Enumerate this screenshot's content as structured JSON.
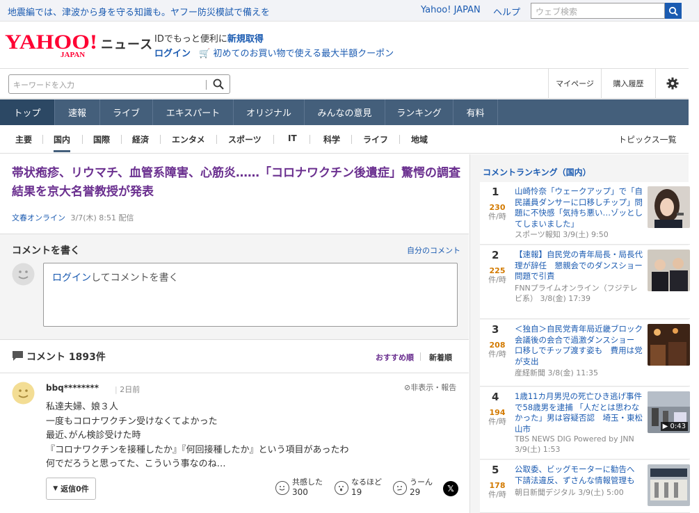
{
  "topbar": {
    "promo": "地震編では、津波から身を守る知識も。ヤフー防災模試で備えを",
    "yahoo_japan": "Yahoo! JAPAN",
    "help": "ヘルプ",
    "search_placeholder": "ウェブ検索"
  },
  "header": {
    "logo_text": "YAHOO!",
    "logo_sub": "JAPAN",
    "service": "ニュース",
    "line1_prefix": "IDでもっと便利に",
    "line1_link": "新規取得",
    "login": "ログイン",
    "coupon": "初めてのお買い物で使える最大半額クーポン"
  },
  "search": {
    "placeholder": "キーワードを入力",
    "mypage": "マイページ",
    "history": "購入履歴"
  },
  "main_nav": [
    "トップ",
    "速報",
    "ライブ",
    "エキスパート",
    "オリジナル",
    "みんなの意見",
    "ランキング",
    "有料"
  ],
  "sub_nav": [
    "主要",
    "国内",
    "国際",
    "経済",
    "エンタメ",
    "スポーツ",
    "IT",
    "科学",
    "ライフ",
    "地域"
  ],
  "topics_all": "トピックス一覧",
  "article": {
    "title": "帯状疱疹、リウマチ、血管系障害、心筋炎……「コロナワクチン後遺症」驚愕の調査結果を京大名誉教授が発表",
    "source": "文春オンライン",
    "date": "3/7(木) 8:51 配信"
  },
  "comment_box": {
    "heading": "コメントを書く",
    "my_comments": "自分のコメント",
    "login_link": "ログイン",
    "prompt": "してコメントを書く"
  },
  "comments": {
    "heading": "コメント 1893件",
    "sort_recommended": "おすすめ順",
    "sort_new": "新着順",
    "items": [
      {
        "user": "bbq********",
        "time": "2日前",
        "hide": "非表示・報告",
        "lines": [
          "私達夫婦、娘３人",
          "一度もコロナワクチン受けなくてよかった",
          "最近､がん検診受けた時",
          "『コロナワクチンを接種したか』『何回接種したか』という項目があったわ",
          "何でだろうと思ってた、こういう事なのね…"
        ],
        "replies": "返信0件",
        "reactions": [
          {
            "label": "共感した",
            "count": "300"
          },
          {
            "label": "なるほど",
            "count": "19"
          },
          {
            "label": "うーん",
            "count": "29"
          }
        ]
      }
    ]
  },
  "ranking": {
    "title": "コメントランキング（国内）",
    "per_hour": "件/時",
    "items": [
      {
        "rank": "1",
        "count": "230",
        "headline": "山崎怜奈「ウェークアップ」で「自民議員ダンサーに口移しチップ」問題に不快感「気持ち悪い…ゾッとしてしまいました」",
        "source": "スポーツ報知 3/9(土) 9:50"
      },
      {
        "rank": "2",
        "count": "225",
        "headline": "【速報】自民党の青年局長・局長代理が辞任　懇親会でのダンスショー問題で引責",
        "source": "FNNプライムオンライン（フジテレビ系） 3/8(金) 17:39"
      },
      {
        "rank": "3",
        "count": "208",
        "headline": "＜独自＞自民党青年局近畿ブロック会議後の会合で過激ダンスショー　口移しでチップ渡す姿も　費用は党が支出",
        "source": "産経新聞 3/8(金) 11:35"
      },
      {
        "rank": "4",
        "count": "194",
        "headline": "1歳11カ月男児の死亡ひき逃げ事件で58歳男を逮捕 「人だとは思わなかった」男は容疑否認　埼玉・東松山市",
        "source": "TBS NEWS DIG Powered by JNN 3/9(土) 1:53",
        "video": "▶ 0:43"
      },
      {
        "rank": "5",
        "count": "178",
        "headline": "公取委、ビッグモーターに勧告へ　下請法違反、ずさんな情報管理も",
        "source": "朝日新聞デジタル 3/9(土) 5:00"
      }
    ]
  },
  "colors": {
    "link": "#1b5bb1",
    "title_purple": "#6a2f8f",
    "nav_bg": "#445f7b",
    "logo_red": "#ff0033",
    "rank_count": "#d37a00"
  }
}
